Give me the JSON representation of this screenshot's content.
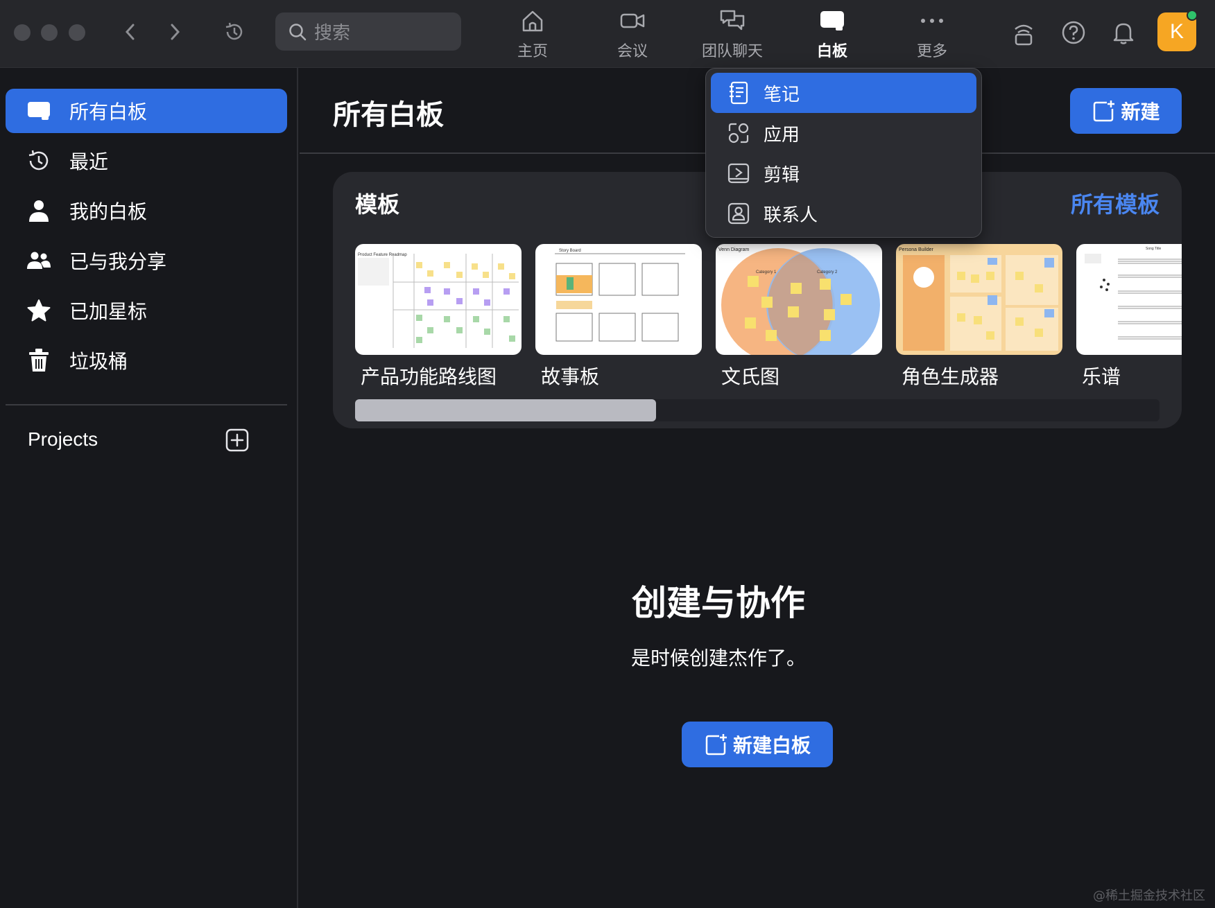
{
  "topbar": {
    "search_placeholder": "搜索",
    "tabs": [
      {
        "label": "主页",
        "icon": "home-icon"
      },
      {
        "label": "会议",
        "icon": "video-icon"
      },
      {
        "label": "团队聊天",
        "icon": "chat-icon"
      },
      {
        "label": "白板",
        "icon": "whiteboard-icon",
        "active": true
      },
      {
        "label": "更多",
        "icon": "more-icon"
      }
    ],
    "avatar_initial": "K",
    "presence_color": "#2fc26b"
  },
  "whiteboard_menu": {
    "items": [
      {
        "label": "笔记",
        "icon": "notes-icon",
        "active": true
      },
      {
        "label": "应用",
        "icon": "apps-icon"
      },
      {
        "label": "剪辑",
        "icon": "clips-icon"
      },
      {
        "label": "联系人",
        "icon": "contacts-icon"
      }
    ]
  },
  "sidebar": {
    "items": [
      {
        "label": "所有白板",
        "icon": "whiteboard-icon",
        "active": true
      },
      {
        "label": "最近",
        "icon": "clock-icon"
      },
      {
        "label": "我的白板",
        "icon": "person-icon"
      },
      {
        "label": "已与我分享",
        "icon": "people-icon"
      },
      {
        "label": "已加星标",
        "icon": "star-icon"
      },
      {
        "label": "垃圾桶",
        "icon": "trash-icon"
      }
    ],
    "projects_label": "Projects"
  },
  "main": {
    "title": "所有白板",
    "new_button": "新建",
    "templates": {
      "title": "模板",
      "all_link": "所有模板",
      "items": [
        {
          "name": "产品功能路线图",
          "thumb_title": "Product Feature Roadmap"
        },
        {
          "name": "故事板",
          "thumb_title": "Story Board"
        },
        {
          "name": "文氏图",
          "thumb_title": "Venn Diagram",
          "category_1": "Category 1",
          "category_2": "Category 2"
        },
        {
          "name": "角色生成器",
          "thumb_title": "Persona Builder"
        },
        {
          "name": "乐谱",
          "thumb_title": "Song Title"
        }
      ],
      "scroll_position": 0.33
    },
    "empty_state": {
      "title": "创建与协作",
      "subtitle": "是时候创建杰作了。",
      "button": "新建白板"
    }
  },
  "colors": {
    "accent": "#2f6de1",
    "link": "#4a86f0",
    "background": "#17181c",
    "topbar": "#26272b"
  },
  "watermark": "@稀土掘金技术社区"
}
